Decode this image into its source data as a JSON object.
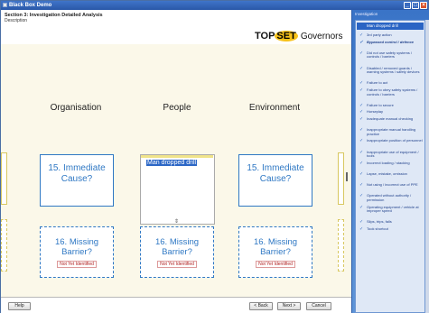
{
  "window": {
    "title": "Black Box Demo"
  },
  "header": {
    "section_title": "Section 3: Investigation Detailed Analysis",
    "description": "Description",
    "logo_top": "TOP",
    "logo_set": "SET",
    "logo_suffix": "Governors"
  },
  "columns": [
    {
      "name": "Organisation"
    },
    {
      "name": "People"
    },
    {
      "name": "Environment"
    }
  ],
  "cause_boxes": [
    {
      "label": "15. Immediate Cause?"
    },
    {
      "label": "15. Immediate Cause?"
    }
  ],
  "people_box": {
    "text": "Man dropped drill"
  },
  "barrier_boxes": [
    {
      "label": "16. Missing Barrier?",
      "status": "Not Yet Identified"
    },
    {
      "label": "16. Missing Barrier?",
      "status": "Not Yet Identified"
    },
    {
      "label": "16. Missing Barrier?",
      "status": "Not Yet Identified"
    }
  ],
  "footer": {
    "help": "Help",
    "back": "< Back",
    "next": "Next >",
    "cancel": "Cancel"
  },
  "right_pane": {
    "title": "Investigation",
    "selected": "Man dropped drill",
    "items": [
      "3rd party action",
      "Bypassed control / defence",
      "Did not use safety systems / controls / barriers",
      "Disabled / removed guards / warning systems / safety devices",
      "Failure to act",
      "Failure to obey safety systems / controls / barriers",
      "Failure to secure",
      "Horseplay",
      "Inadequate manual checking",
      "Inappropriate manual handling practice",
      "Inappropriate position of personnel",
      "Inappropriate use of equipment / tools",
      "Incorrect loading / stacking",
      "Lapse, mistake, omission",
      "Not using / incorrect use of PPE",
      "Operated without authority / permission",
      "Operating equipment / vehicle at improper speed",
      "Slips, trips, falls",
      "Took shortcut"
    ]
  }
}
